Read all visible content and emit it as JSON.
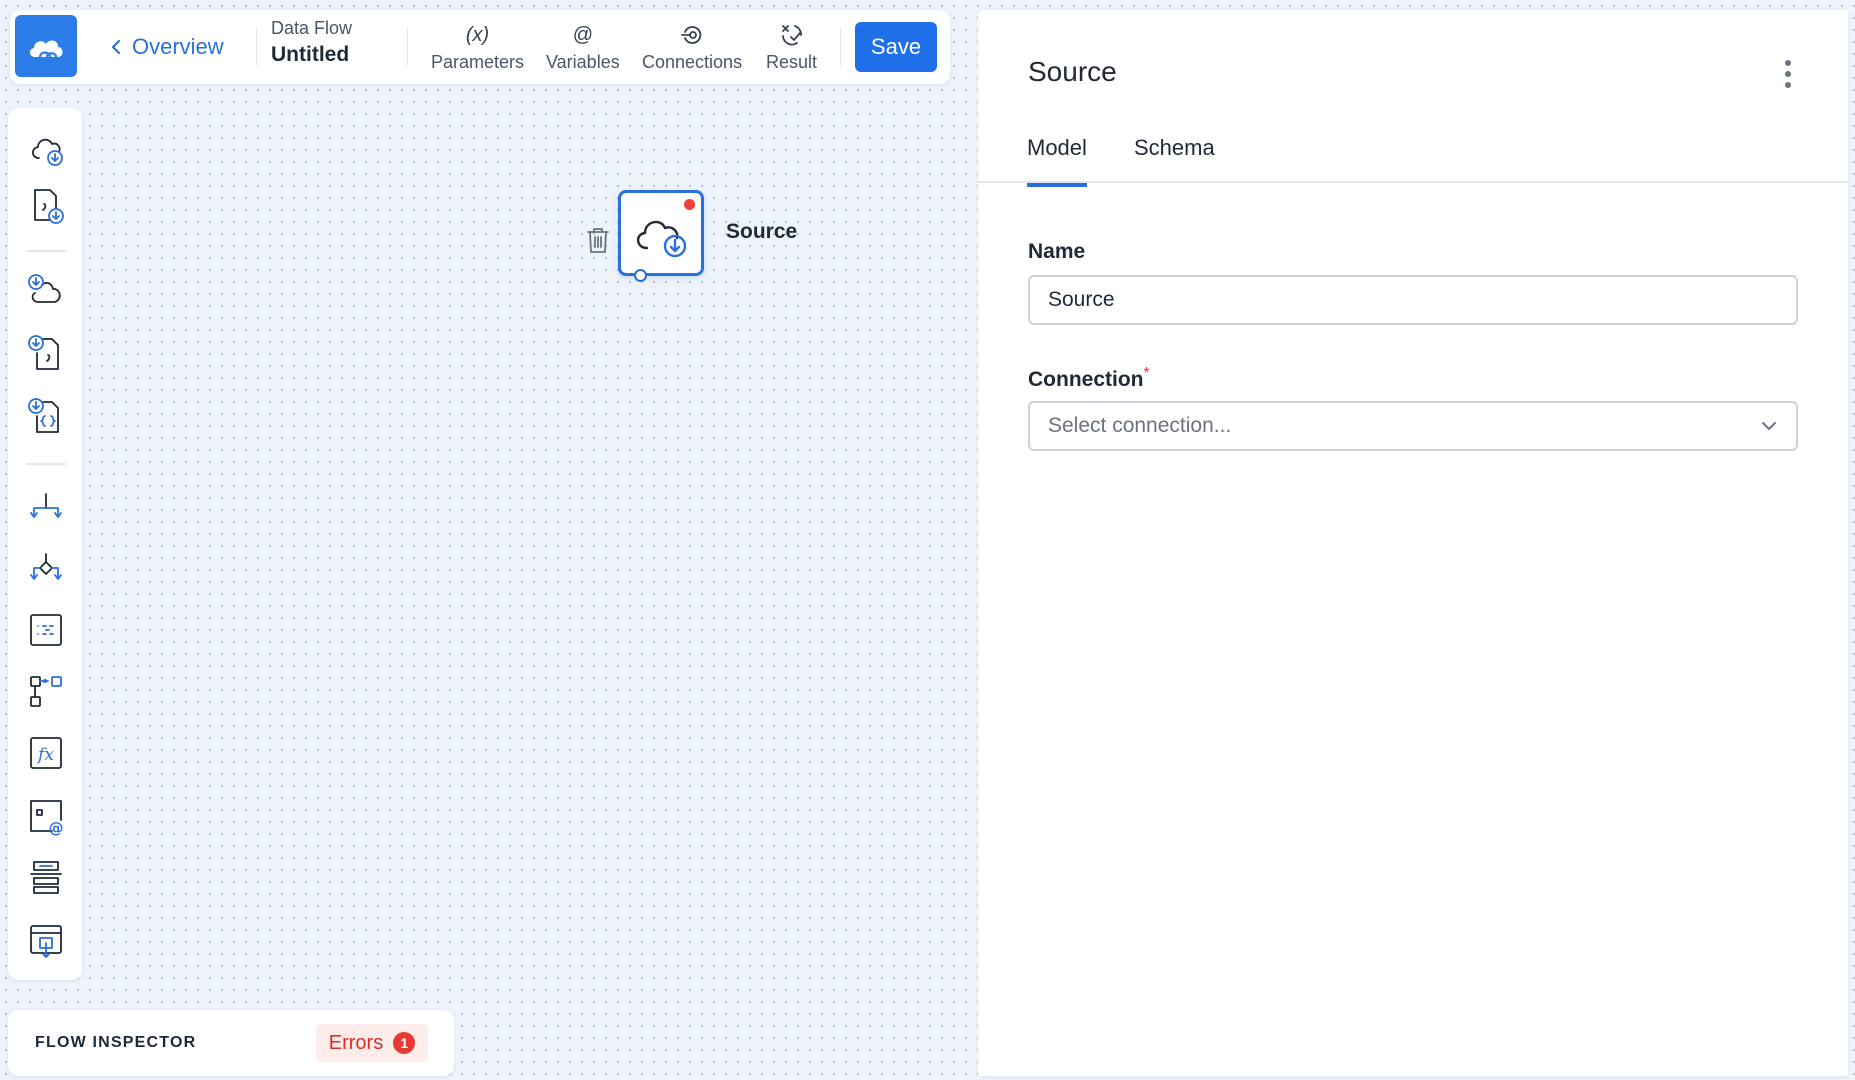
{
  "header": {
    "back_label": "Overview",
    "flow_type": "Data Flow",
    "flow_name": "Untitled",
    "tools": [
      {
        "glyph": "(x)",
        "label": "Parameters"
      },
      {
        "glyph": "@",
        "label": "Variables"
      },
      {
        "glyph": "",
        "label": "Connections"
      },
      {
        "glyph": "",
        "label": "Result"
      }
    ],
    "save_label": "Save"
  },
  "canvas": {
    "node_label": "Source"
  },
  "inspector": {
    "title": "FLOW INSPECTOR",
    "errors_label": "Errors",
    "errors_count": "1"
  },
  "panel": {
    "title": "Source",
    "tabs": [
      {
        "label": "Model"
      },
      {
        "label": "Schema"
      }
    ],
    "name_label": "Name",
    "name_value": "Source",
    "connection_label": "Connection",
    "required_mark": "*",
    "connection_placeholder": "Select connection..."
  },
  "colors": {
    "accent": "#2a6fdb",
    "brand": "#2b7ce9",
    "error": "#e53935"
  }
}
